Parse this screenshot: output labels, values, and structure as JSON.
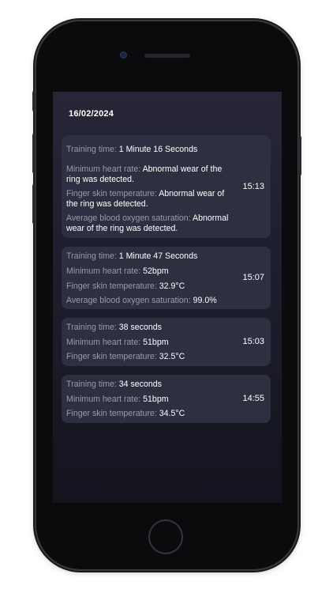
{
  "date": "16/02/2024",
  "records": [
    {
      "time": "15:13",
      "items": [
        {
          "label": "Training time: ",
          "value": "1 Minute 16 Seconds"
        },
        {
          "label": "Minimum heart rate: ",
          "value": "Abnormal wear of the ring was detected."
        },
        {
          "label": "Finger skin temperature: ",
          "value": "Abnormal wear of the ring was detected."
        },
        {
          "label": "Average blood oxygen saturation: ",
          "value": "Abnormal wear of the ring was detected."
        }
      ]
    },
    {
      "time": "15:07",
      "items": [
        {
          "label": "Training time: ",
          "value": "1 Minute 47 Seconds"
        },
        {
          "label": "Minimum heart rate: ",
          "value": "52bpm"
        },
        {
          "label": "Finger skin temperature: ",
          "value": "32.9°C"
        },
        {
          "label": "Average blood oxygen saturation: ",
          "value": "99.0%"
        }
      ]
    },
    {
      "time": "15:03",
      "items": [
        {
          "label": "Training time: ",
          "value": "38 seconds"
        },
        {
          "label": "Minimum heart rate: ",
          "value": "51bpm"
        },
        {
          "label": "Finger skin temperature: ",
          "value": "32.5°C"
        }
      ]
    },
    {
      "time": "14:55",
      "items": [
        {
          "label": "Training time: ",
          "value": "34 seconds"
        },
        {
          "label": "Minimum heart rate: ",
          "value": "51bpm"
        },
        {
          "label": "Finger skin temperature: ",
          "value": "34.5°C"
        }
      ]
    }
  ]
}
